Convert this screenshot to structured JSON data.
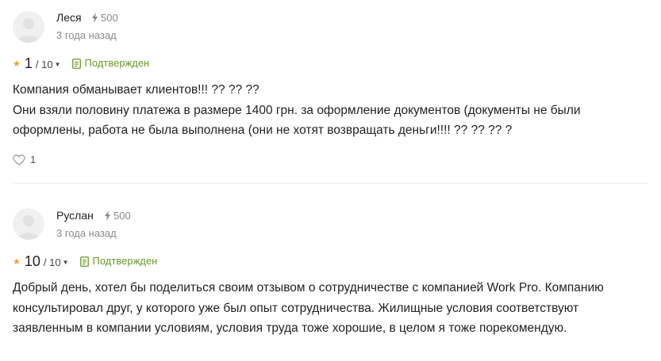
{
  "reviews": [
    {
      "author": "Леся",
      "karma": "500",
      "time": "3 года назад",
      "rating": "1",
      "rating_max": "/ 10",
      "status": "Подтвержден",
      "lines": [
        "Компания обманывает клиентов!!! ??  ??  ??",
        "Они взяли половину платежа в размере 1400 грн. за оформление документов (документы не были оформлены, работа не была выполнена (они не хотят возвращать деньги!!!! ??  ??  ?? ?"
      ],
      "likes": "1"
    },
    {
      "author": "Руслан",
      "karma": "500",
      "time": "3 года назад",
      "rating": "10",
      "rating_max": "/ 10",
      "status": "Подтвержден",
      "lines": [
        "Добрый день, хотел бы поделиться своим отзывом о сотрудничестве с компанией Work Pro. Компанию консультировал друг, у которого уже был опыт сотрудничества. Жилищные условия соответствуют заявленным в компании условиям, условия труда тоже хорошие, в целом я тоже порекомендую."
      ]
    }
  ],
  "colors": {
    "accent_star": "#f0a020",
    "verified": "#6a9a2a",
    "muted": "#8a8a8a"
  },
  "icons": {
    "karma": "lightning-icon",
    "verified": "document-check-icon",
    "like": "heart-icon",
    "avatar": "user-placeholder-icon"
  }
}
